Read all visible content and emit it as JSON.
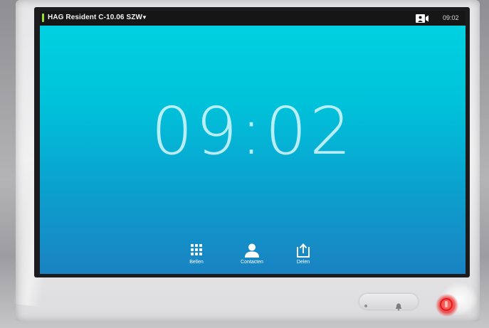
{
  "status_bar": {
    "device_name": "HAG Resident C-10.06 SZW",
    "dropdown_caret": "▼",
    "camera_icon": "camera-self-view-icon",
    "time": "09:02"
  },
  "clock": {
    "time": "09:02"
  },
  "dock": {
    "items": [
      {
        "label": "Bellen",
        "icon": "keypad-icon"
      },
      {
        "label": "Contacten",
        "icon": "person-icon"
      },
      {
        "label": "Delen",
        "icon": "share-upload-icon"
      }
    ]
  },
  "hardware": {
    "buttons": [
      "dot-icon",
      "bell-icon",
      "microphone-mute-icon"
    ],
    "mute_active_color": "#e21b1b"
  },
  "colors": {
    "screen_top": "#00d4e2",
    "screen_bottom": "#1a82c2",
    "status_indicator": "#9be029",
    "status_bar_bg": "#161616"
  }
}
